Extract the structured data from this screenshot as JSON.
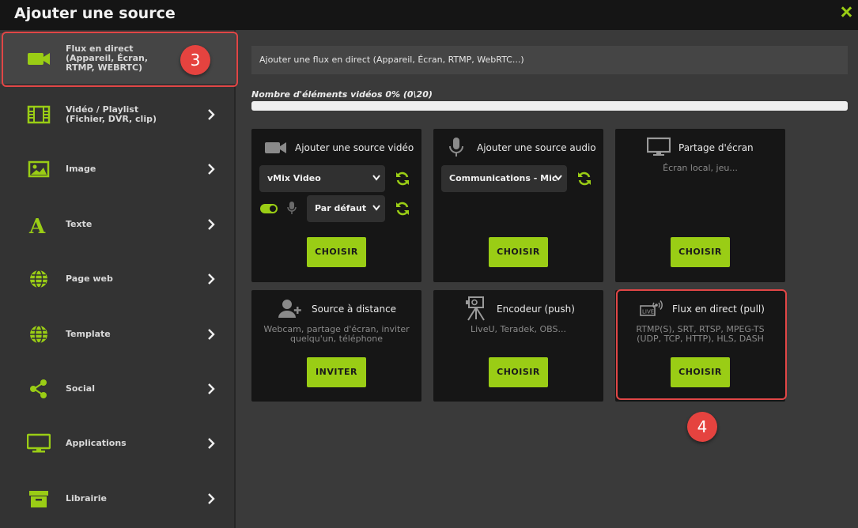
{
  "window": {
    "title": "Ajouter une source"
  },
  "sidebar": {
    "items": [
      {
        "label": "Flux en direct\n(Appareil, Écran,\nRTMP, WEBRTC)",
        "icon": "video-camera-icon"
      },
      {
        "label": "Vidéo / Playlist\n(Fichier, DVR, clip)",
        "icon": "film-strip-icon"
      },
      {
        "label": "Image",
        "icon": "image-icon"
      },
      {
        "label": "Texte",
        "icon": "text-a-icon"
      },
      {
        "label": "Page web",
        "icon": "globe-icon"
      },
      {
        "label": "Template",
        "icon": "globe-icon"
      },
      {
        "label": "Social",
        "icon": "share-icon"
      },
      {
        "label": "Applications",
        "icon": "monitor-icon"
      },
      {
        "label": "Librairie",
        "icon": "archive-box-icon"
      }
    ]
  },
  "annotations": {
    "step3": "3",
    "step4": "4"
  },
  "main": {
    "info_text": "Ajouter une flux en direct (Appareil, Écran, RTMP, WebRTC...)",
    "count_label": "Nombre d'éléments vidéos 0% (0\\20)",
    "progress_fraction": 0.0
  },
  "cards": {
    "video_source": {
      "title": "Ajouter une source vidéo",
      "select_value": "vMix Video",
      "audio_select_value": "Par défaut",
      "toggle_on": true,
      "button": "CHOISIR"
    },
    "audio_source": {
      "title": "Ajouter une source audio",
      "select_value": "Communications - Mic",
      "button": "CHOISIR"
    },
    "screen_share": {
      "title": "Partage d'écran",
      "desc": "Écran local, jeu...",
      "button": "CHOISIR"
    },
    "remote_source": {
      "title": "Source à distance",
      "desc": "Webcam, partage d'écran, inviter\nquelqu'un, téléphone",
      "button": "INVITER"
    },
    "encoder": {
      "title": "Encodeur (push)",
      "desc": "LiveU, Teradek, OBS...",
      "button": "CHOISIR"
    },
    "live_pull": {
      "title": "Flux en direct (pull)",
      "desc": "RTMP(S), SRT, RTSP, MPEG-TS\n(UDP, TCP, HTTP), HLS, DASH",
      "button": "CHOISIR"
    }
  },
  "colors": {
    "accent": "#9acd15",
    "highlight": "#e14646",
    "badge": "#e5433f",
    "card_bg": "#161616",
    "background": "#3a3a3a"
  }
}
